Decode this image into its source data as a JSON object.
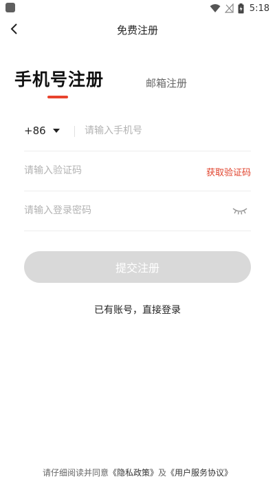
{
  "status_bar": {
    "time": "5:18"
  },
  "header": {
    "title": "免费注册"
  },
  "tabs": {
    "phone": "手机号注册",
    "email": "邮箱注册"
  },
  "form": {
    "country_code": "+86",
    "phone_placeholder": "请输入手机号",
    "code_placeholder": "请输入验证码",
    "get_code_label": "获取验证码",
    "password_placeholder": "请输入登录密码"
  },
  "submit_label": "提交注册",
  "login_link": "已有账号，直接登录",
  "footer": {
    "prefix": "请仔细阅读并同意",
    "privacy_link": "《隐私政策》",
    "and": "及",
    "terms_link": "《用户服务协议》"
  },
  "colors": {
    "accent": "#e8432d",
    "button_disabled": "#d9d9d9"
  }
}
